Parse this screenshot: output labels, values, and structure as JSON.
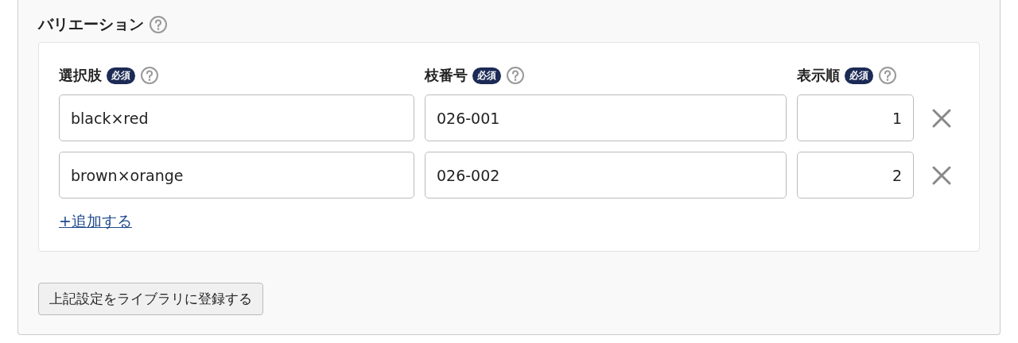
{
  "section": {
    "title": "バリエーション"
  },
  "columns": [
    {
      "label": "選択肢",
      "badge": "必須",
      "kind": "text"
    },
    {
      "label": "枝番号",
      "badge": "必須",
      "kind": "text"
    },
    {
      "label": "表示順",
      "badge": "必須",
      "kind": "number"
    }
  ],
  "rows": [
    {
      "values": [
        "black×red",
        "026-001",
        "1"
      ]
    },
    {
      "values": [
        "brown×orange",
        "026-002",
        "2"
      ]
    }
  ],
  "add_link": "+追加する",
  "register_button": "上記設定をライブラリに登録する"
}
